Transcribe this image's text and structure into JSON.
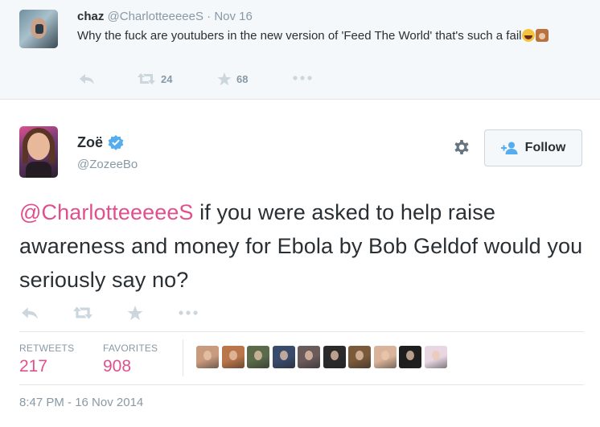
{
  "parent_tweet": {
    "name": "chaz",
    "handle": "@CharlotteeeeeS",
    "dot": "·",
    "time": "Nov 16",
    "text": "Why the fuck are youtubers in the new version of 'Feed The World' that's such a fail",
    "retweets": "24",
    "favorites": "68"
  },
  "main_tweet": {
    "name": "Zoë",
    "handle": "@ZozeeBo",
    "follow_label": "Follow",
    "mention": "@CharlotteeeeeS",
    "text": " if you were asked to help raise awareness and money for Ebola by Bob Geldof would you seriously say no?",
    "stats": {
      "retweets_label": "RETWEETS",
      "retweets_value": "217",
      "favorites_label": "FAVORITES",
      "favorites_value": "908"
    },
    "timestamp": "8:47 PM - 16 Nov 2014"
  },
  "colors": {
    "accent": "#e0508f",
    "muted": "#8899a6",
    "icon": "#ccd6dd",
    "verified": "#55acee"
  },
  "favoriters": [
    {
      "name": "favoriter-avatar-1",
      "bg": "#c89a7e"
    },
    {
      "name": "favoriter-avatar-2",
      "bg": "#b8764a"
    },
    {
      "name": "favoriter-avatar-3",
      "bg": "#5a6a4a"
    },
    {
      "name": "favoriter-avatar-4",
      "bg": "#3a4a6a"
    },
    {
      "name": "favoriter-avatar-5",
      "bg": "#6a5a5a"
    },
    {
      "name": "favoriter-avatar-6",
      "bg": "#2a2a2a"
    },
    {
      "name": "favoriter-avatar-7",
      "bg": "#7a5a3a"
    },
    {
      "name": "favoriter-avatar-8",
      "bg": "#d9b49a"
    },
    {
      "name": "favoriter-avatar-9",
      "bg": "#1e1e1e"
    },
    {
      "name": "favoriter-avatar-10",
      "bg": "#e8d7e3"
    }
  ]
}
